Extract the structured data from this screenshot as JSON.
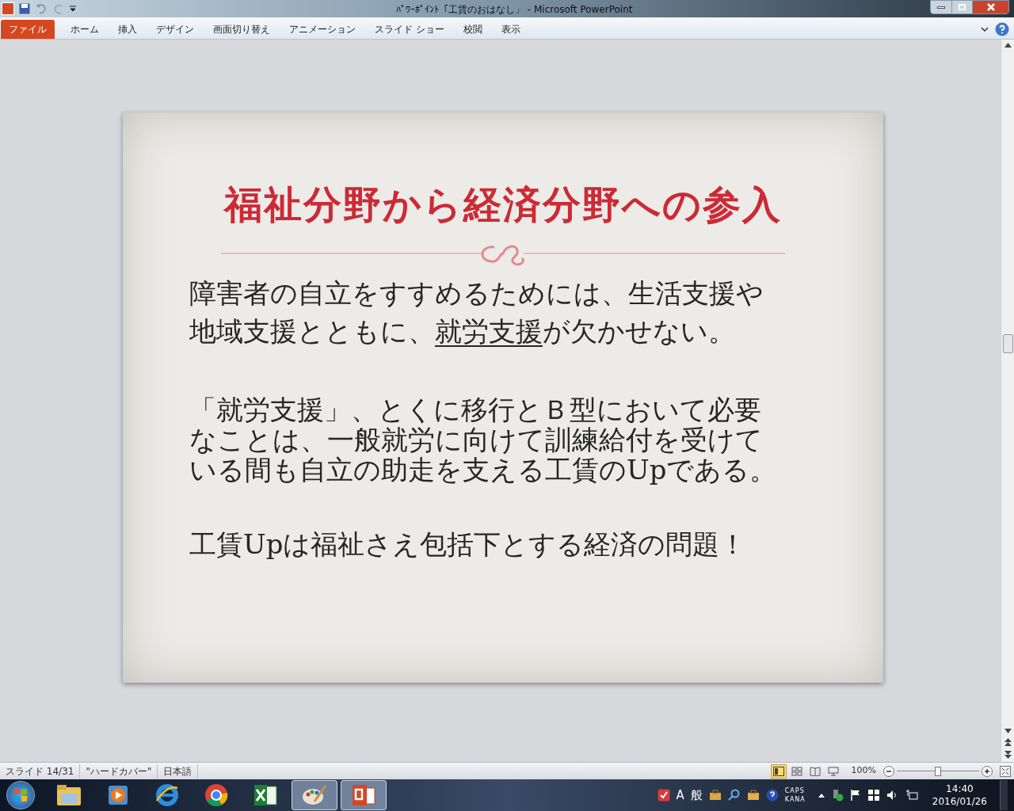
{
  "window": {
    "title": "ﾊﾟﾜｰﾎﾟｲﾝﾄ「工賃のおはなし」 - Microsoft PowerPoint"
  },
  "ribbon_tabs": [
    {
      "label": "ファイル",
      "kind": "file",
      "selected": false
    },
    {
      "label": "ホーム",
      "kind": "tab",
      "selected": false
    },
    {
      "label": "挿入",
      "kind": "tab",
      "selected": false
    },
    {
      "label": "デザイン",
      "kind": "tab",
      "selected": false
    },
    {
      "label": "画面切り替え",
      "kind": "tab",
      "selected": false
    },
    {
      "label": "アニメーション",
      "kind": "tab",
      "selected": false
    },
    {
      "label": "スライド ショー",
      "kind": "tab",
      "selected": false
    },
    {
      "label": "校閲",
      "kind": "tab",
      "selected": false
    },
    {
      "label": "表示",
      "kind": "tab",
      "selected": false
    }
  ],
  "slide": {
    "title": "福祉分野から経済分野への参入",
    "paragraphs": [
      {
        "lines": [
          {
            "kind": "plain",
            "text": "障害者の自立をすすめるためには、生活支援や"
          },
          {
            "kind": "underlined",
            "before": "地域支援とともに、",
            "underlined": "就労支援",
            "after": "が欠かせない。"
          }
        ]
      },
      {
        "lines": [
          {
            "kind": "plain",
            "text": "「就労支援」、とくに移行とＢ型において必要"
          },
          {
            "kind": "plain",
            "text": "なことは、一般就労に向けて訓練給付を受けて"
          },
          {
            "kind": "plain",
            "text": "いる間も自立の助走を支える工賃のUpである。"
          }
        ]
      },
      {
        "lines": [
          {
            "kind": "plain",
            "text": "工賃Upは福祉さえ包括下とする経済の問題！"
          }
        ]
      }
    ]
  },
  "status_bar": {
    "items": [
      "スライド 14/31",
      "\"ハードカバー\"",
      "日本語"
    ],
    "views": [
      {
        "kind": "normal",
        "selected": true
      },
      {
        "kind": "sorter",
        "selected": false
      },
      {
        "kind": "reading",
        "selected": false
      },
      {
        "kind": "show",
        "selected": false
      }
    ],
    "zoom": "100%",
    "zoom_slider": {
      "level": 0.5
    }
  },
  "taskbar": {
    "apps": [
      {
        "kind": "folder",
        "running": false
      },
      {
        "kind": "media",
        "running": false
      },
      {
        "kind": "browser",
        "running": false
      },
      {
        "kind": "chrome",
        "running": false
      },
      {
        "kind": "spreadsheet",
        "running": false
      },
      {
        "kind": "paint",
        "running": true
      },
      {
        "kind": "presentation",
        "running": true
      }
    ],
    "ime": [
      "A",
      "般"
    ],
    "caps": "CAPS",
    "kana": "KANA",
    "time": "14:40",
    "date": "2016/01/26"
  }
}
